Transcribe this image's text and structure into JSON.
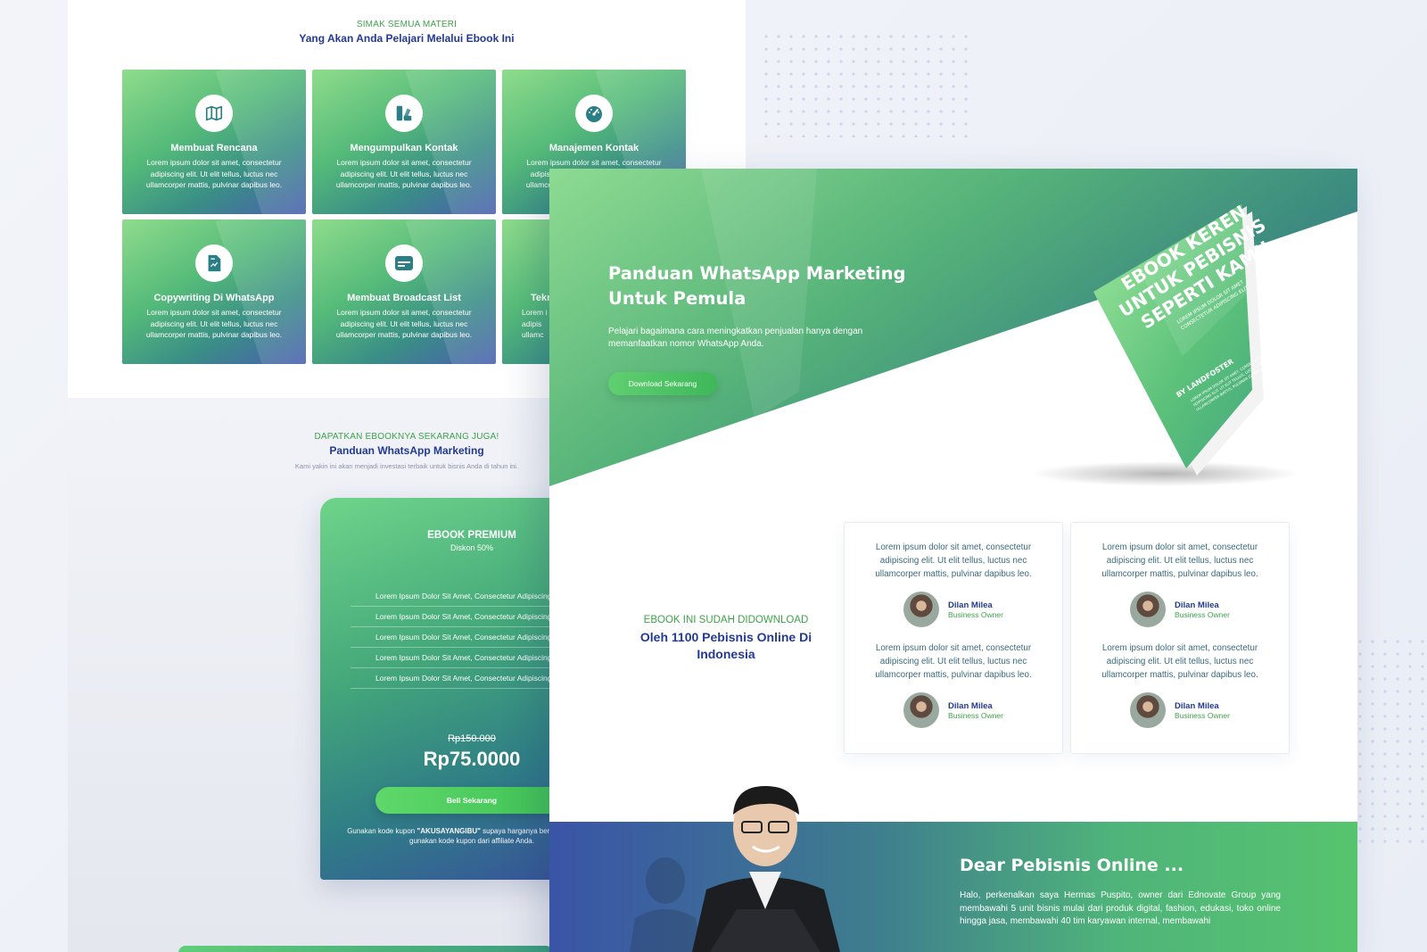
{
  "materials": {
    "eyebrow": "SIMAK SEMUA MATERI",
    "title": "Yang Akan Anda Pelajari Melalui Ebook Ini",
    "cards": [
      {
        "title": "Membuat Rencana",
        "desc": "Lorem ipsum dolor sit amet, consectetur adipiscing elit. Ut elit tellus, luctus nec ullamcorper mattis, pulvinar dapibus leo.",
        "icon": "map-icon"
      },
      {
        "title": "Mengumpulkan Kontak",
        "desc": "Lorem ipsum dolor sit amet, consectetur adipiscing elit. Ut elit tellus, luctus nec ullamcorper mattis, pulvinar dapibus leo.",
        "icon": "swatch-icon"
      },
      {
        "title": "Manajemen Kontak",
        "desc": "Lorem ipsum dolor sit amet, consectetur adipiscing elit. Ut elit tellus, luctus nec ullamcorper mattis, pulvinar dapibus leo.",
        "icon": "gauge-icon"
      },
      {
        "title": "Copywriting Di WhatsApp",
        "desc": "Lorem ipsum dolor sit amet, consectetur adipiscing elit. Ut elit tellus, luctus nec ullamcorper mattis, pulvinar dapibus leo.",
        "icon": "document-icon"
      },
      {
        "title": "Membuat Broadcast List",
        "desc": "Lorem ipsum dolor sit amet, consectetur adipiscing elit. Ut elit tellus, luctus nec ullamcorper mattis, pulvinar dapibus leo.",
        "icon": "card-icon"
      },
      {
        "title": "Tekn",
        "desc": "Lorem i adipis ullamc",
        "icon": "partial-icon"
      }
    ]
  },
  "offer": {
    "eyebrow": "DAPATKAN EBOOKNYA SEKARANG JUGA!",
    "title": "Panduan WhatsApp Marketing",
    "subtitle": "Kami yakin ini akan menjadi investasi terbaik untuk bisnis Anda di tahun ini."
  },
  "pricing": {
    "title": "EBOOK PREMIUM",
    "subtitle": "Diskon 50%",
    "features": [
      "Lorem Ipsum Dolor Sit Amet, Consectetur Adipiscing Elit.",
      "Lorem Ipsum Dolor Sit Amet, Consectetur Adipiscing Elit.",
      "Lorem Ipsum Dolor Sit Amet, Consectetur Adipiscing Elit.",
      "Lorem Ipsum Dolor Sit Amet, Consectetur Adipiscing Elit.",
      "Lorem Ipsum Dolor Sit Amet, Consectetur Adipiscing Elit."
    ],
    "old_price": "Rp150.000",
    "new_price": "Rp75.0000",
    "button": "Beli Sekarang",
    "note_before": "Gunakan kode kupon ",
    "note_code": "\"AKUSAYANGIBU\"",
    "note_after": " supaya harganya berubah atau bisa gunakan kode kupon dari affiliate Anda."
  },
  "hero": {
    "title": "Panduan WhatsApp Marketing Untuk Pemula",
    "desc": "Pelajari bagaimana cara meningkatkan penjualan hanya dengan memanfaatkan nomor WhatsApp Anda.",
    "button": "Download Sekarang",
    "book_line1": "EBOOK KEREN",
    "book_line2": "UNTUK PEBISNIS",
    "book_line3": "SEPERTI KAMU",
    "book_sub1": "LOREM IPSUM DOLOR SIT AMET",
    "book_sub2": "CONSECTETUR ADIPISCING ELIT",
    "book_author": "BY LANDFOSTER",
    "book_foot1": "LOREM IPSUM DOLOR SIT AMET, CONSECTETUR",
    "book_foot2": "ADIPISCING ELIT. UT ELIT TELLUS, LUCTUS NEC",
    "book_foot3": "ULLAMCORPER MATTIS, PULVINAR DAPIBUS LEO."
  },
  "downloads": {
    "eyebrow": "EBOOK INI SUDAH DIDOWNLOAD",
    "title": "Oleh 1100 Pebisnis Online Di Indonesia"
  },
  "testimonials": [
    {
      "quote": "Lorem ipsum dolor sit amet, consectetur adipiscing elit. Ut elit tellus, luctus nec ullamcorper mattis, pulvinar dapibus leo.",
      "name": "Dilan Milea",
      "role": "Business Owner"
    },
    {
      "quote": "Lorem ipsum dolor sit amet, consectetur adipiscing elit. Ut elit tellus, luctus nec ullamcorper mattis, pulvinar dapibus leo.",
      "name": "Dilan Milea",
      "role": "Business Owner"
    },
    {
      "quote": "Lorem ipsum dolor sit amet, consectetur adipiscing elit. Ut elit tellus, luctus nec ullamcorper mattis, pulvinar dapibus leo.",
      "name": "Dilan Milea",
      "role": "Business Owner"
    },
    {
      "quote": "Lorem ipsum dolor sit amet, consectetur adipiscing elit. Ut elit tellus, luctus nec ullamcorper mattis, pulvinar dapibus leo.",
      "name": "Dilan Milea",
      "role": "Business Owner"
    }
  ],
  "intro": {
    "title": "Dear Pebisnis Online ...",
    "body": "Halo, perkenalkan saya Hermas Puspito, owner dari Ednovate Group yang membawahi 5 unit bisnis mulai dari produk digital, fashion, edukasi, toko online hingga jasa, membawahi 40 tim karyawan internal, membawahi"
  }
}
